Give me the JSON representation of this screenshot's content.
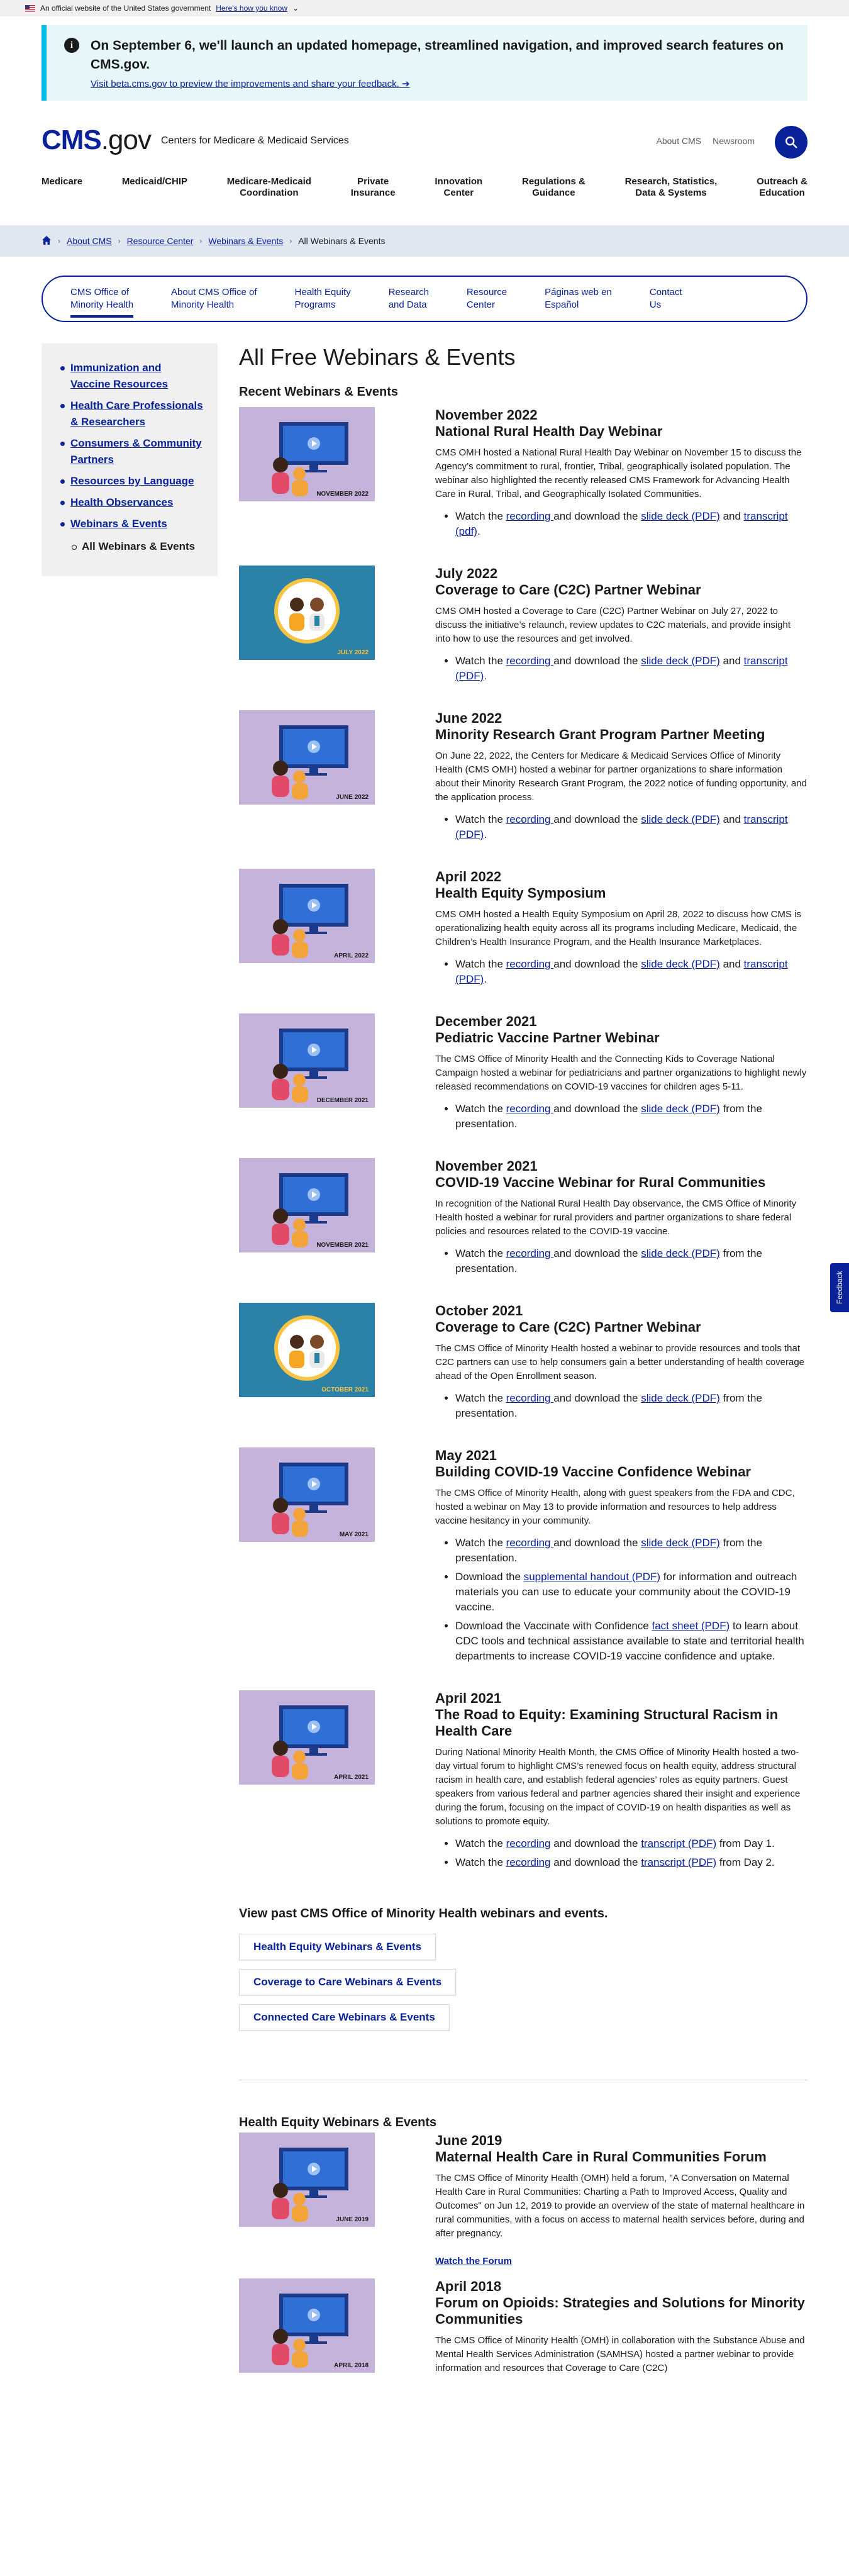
{
  "gov_banner": {
    "text": "An official website of the United States government",
    "link": "Here's how you know"
  },
  "alert": {
    "heading": "On September 6, we'll launch an updated homepage, streamlined navigation, and improved search features on CMS.gov.",
    "link": "Visit beta.cms.gov to preview the improvements and share your feedback. ➔"
  },
  "header": {
    "logo_cms": "CMS",
    "logo_gov": ".gov",
    "subtitle": "Centers for Medicare & Medicaid Services",
    "utility": [
      "About CMS",
      "Newsroom"
    ]
  },
  "mainnav": [
    "Medicare",
    "Medicaid/CHIP",
    "Medicare-Medicaid\nCoordination",
    "Private\nInsurance",
    "Innovation\nCenter",
    "Regulations &\nGuidance",
    "Research, Statistics,\nData & Systems",
    "Outreach &\nEducation"
  ],
  "breadcrumb": [
    "About CMS",
    "Resource Center",
    "Webinars & Events",
    "All Webinars & Events"
  ],
  "subnav": [
    "CMS Office of\nMinority Health",
    "About CMS Office of\nMinority Health",
    "Health Equity\nPrograms",
    "Research\nand Data",
    "Resource\nCenter",
    "Páginas web en\nEspañol",
    "Contact\nUs"
  ],
  "sidebar": {
    "items": [
      "Immunization and Vaccine Resources",
      "Health Care Professionals & Researchers",
      "Consumers & Community Partners",
      "Resources by Language",
      "Health Observances",
      "Webinars & Events"
    ],
    "child": "All Webinars & Events"
  },
  "page_title": "All Free Webinars & Events",
  "recent_heading": "Recent Webinars & Events",
  "webinars": [
    {
      "thumb_date": "NOVEMBER 2022",
      "date": "November 2022",
      "title": "National Rural Health Day Webinar",
      "desc": "CMS OMH hosted a National Rural Health Day Webinar on November 15 to discuss the Agency’s commitment to rural, frontier, Tribal, geographically isolated population. The webinar also highlighted the recently released CMS Framework for Advancing Health Care in Rural, Tribal, and Geographically Isolated Communities.",
      "style": "purple",
      "bullets": [
        {
          "pre": "Watch the ",
          "l1": "recording ",
          "mid": "and download the ",
          "l2": "slide deck (PDF)",
          "mid2": " and ",
          "l3": "transcript (pdf)",
          "post": "."
        }
      ]
    },
    {
      "thumb_date": "JULY 2022",
      "date": "July 2022",
      "title": "Coverage to Care (C2C) Partner Webinar",
      "desc": "CMS OMH hosted a Coverage to Care (C2C) Partner Webinar on July 27, 2022 to discuss the initiative’s relaunch, review updates to C2C materials, and provide insight into how to use the resources and get involved.",
      "style": "teal",
      "bullets": [
        {
          "pre": "Watch the ",
          "l1": "recording ",
          "mid": "and download the ",
          "l2": "slide deck (PDF)",
          "mid2": " and ",
          "l3": "transcript (PDF)",
          "post": "."
        }
      ]
    },
    {
      "thumb_date": "JUNE 2022",
      "date": "June 2022",
      "title": "Minority Research Grant Program Partner Meeting",
      "desc": "On June 22, 2022, the Centers for Medicare & Medicaid Services Office of Minority Health (CMS OMH) hosted a webinar for partner organizations to share information about their Minority Research Grant Program, the 2022 notice of funding opportunity, and the application process.",
      "style": "purple",
      "bullets": [
        {
          "pre": "Watch the ",
          "l1": "recording ",
          "mid": "and download the ",
          "l2": "slide deck (PDF)",
          "mid2": " and ",
          "l3": "transcript (PDF)",
          "post": "."
        }
      ]
    },
    {
      "thumb_date": "APRIL 2022",
      "date": "April 2022",
      "title": "Health Equity Symposium",
      "desc": "CMS OMH hosted a Health Equity Symposium on April 28, 2022 to discuss how CMS is operationalizing health equity across all its programs including Medicare, Medicaid, the Children’s Health Insurance Program, and the Health Insurance Marketplaces.",
      "style": "purple",
      "bullets": [
        {
          "pre": "Watch the ",
          "l1": "recording ",
          "mid": "and download the ",
          "l2": "slide deck (PDF)",
          "mid2": " and ",
          "l3": "transcript (PDF)",
          "post": "."
        }
      ]
    },
    {
      "thumb_date": "DECEMBER 2021",
      "date": "December 2021",
      "title": "Pediatric Vaccine Partner Webinar",
      "desc": "The CMS Office of Minority Health and the Connecting Kids to Coverage National Campaign hosted a webinar for pediatricians and partner organizations to highlight newly released recommendations on COVID-19 vaccines for children ages 5-11.",
      "style": "purple",
      "bullets": [
        {
          "pre": "Watch the ",
          "l1": "recording ",
          "mid": "and download the ",
          "l2": "slide deck (PDF)",
          "mid2": " from the presentation.",
          "l3": "",
          "post": ""
        }
      ]
    },
    {
      "thumb_date": "NOVEMBER 2021",
      "date": "November 2021",
      "title": "COVID-19 Vaccine Webinar for Rural Communities",
      "desc": "In recognition of the National Rural Health Day observance, the CMS Office of Minority Health hosted a webinar for rural providers and partner organizations to share federal policies and resources related to the COVID-19 vaccine.",
      "style": "purple",
      "bullets": [
        {
          "pre": "Watch the ",
          "l1": "recording ",
          "mid": "and download the ",
          "l2": "slide deck (PDF)",
          "mid2": " from the presentation.",
          "l3": "",
          "post": ""
        }
      ]
    },
    {
      "thumb_date": "OCTOBER 2021",
      "date": "October 2021",
      "title": "Coverage to Care (C2C) Partner Webinar",
      "desc": "The CMS Office of Minority Health hosted a webinar to provide resources and tools that C2C partners can use to help consumers gain a better understanding of health coverage ahead of the Open Enrollment season.",
      "style": "teal",
      "bullets": [
        {
          "pre": "Watch the ",
          "l1": "recording ",
          "mid": "and download the ",
          "l2": "slide deck (PDF)",
          "mid2": " from the presentation.",
          "l3": "",
          "post": ""
        }
      ]
    },
    {
      "thumb_date": "MAY 2021",
      "date": "May 2021",
      "title": "Building COVID-19 Vaccine Confidence Webinar",
      "desc": "The CMS Office of Minority Health, along with guest speakers from the FDA and CDC, hosted a webinar on May 13 to provide information and resources to help address vaccine hesitancy in your community.",
      "style": "purple",
      "bullets": [
        {
          "pre": "Watch the ",
          "l1": "recording ",
          "mid": "and download the ",
          "l2": "slide deck (PDF)",
          "mid2": " from the presentation.",
          "l3": "",
          "post": ""
        },
        {
          "pre": "Download the ",
          "l1": "supplemental handout (PDF)",
          "mid": " for information and outreach materials you can use to educate your community about the COVID-19 vaccine.",
          "l2": "",
          "mid2": "",
          "l3": "",
          "post": ""
        },
        {
          "pre": "Download the Vaccinate with Confidence ",
          "l1": "fact sheet (PDF)",
          "mid": " to learn about CDC tools and technical assistance available to state and territorial health departments to increase COVID-19 vaccine confidence and uptake.",
          "l2": "",
          "mid2": "",
          "l3": "",
          "post": ""
        }
      ]
    },
    {
      "thumb_date": "APRIL 2021",
      "date": "April 2021",
      "title": "The Road to Equity: Examining Structural Racism in Health Care",
      "desc": "During National Minority Health Month, the CMS Office of Minority Health hosted a two-day virtual forum to highlight CMS’s renewed focus on health equity, address structural racism in health care, and establish federal agencies’ roles as equity partners. Guest speakers from various federal and partner agencies shared their insight and experience during the forum, focusing on the impact of COVID-19 on health disparities as well as solutions to promote equity.",
      "style": "purple",
      "bullets": [
        {
          "pre": "Watch the ",
          "l1": "recording",
          "mid": " and download the ",
          "l2": "transcript (PDF)",
          "mid2": " from Day 1.",
          "l3": "",
          "post": ""
        },
        {
          "pre": "Watch the ",
          "l1": "recording",
          "mid": " and download the ",
          "l2": "transcript (PDF)",
          "mid2": " from Day 2.",
          "l3": "",
          "post": ""
        }
      ]
    }
  ],
  "past": {
    "heading": "View past CMS Office of Minority Health webinars and events.",
    "buttons": [
      "Health Equity Webinars & Events",
      "Coverage to Care Webinars & Events",
      "Connected Care Webinars & Events"
    ]
  },
  "health_equity": {
    "heading": "Health Equity Webinars & Events",
    "items": [
      {
        "thumb_date": "JUNE 2019",
        "date": "June 2019",
        "title": "Maternal Health Care in Rural Communities Forum",
        "desc": "The CMS Office of Minority Health (OMH) held a forum, \"A Conversation on Maternal Health Care in Rural Communities: Charting a Path to Improved Access, Quality and Outcomes\" on Jun 12, 2019 to provide an overview of the state of maternal healthcare in rural communities, with a focus on access to maternal health services before, during and after pregnancy.",
        "link": "Watch the Forum"
      },
      {
        "thumb_date": "APRIL 2018",
        "date": "April 2018",
        "title": "Forum on Opioids: Strategies and Solutions for Minority Communities",
        "desc": "The CMS Office of Minority Health (OMH) in collaboration with the Substance Abuse and Mental Health Services Administration (SAMHSA) hosted a partner webinar to provide information and resources that Coverage to Care (C2C)",
        "link": ""
      }
    ]
  },
  "feedback": "Feedback"
}
